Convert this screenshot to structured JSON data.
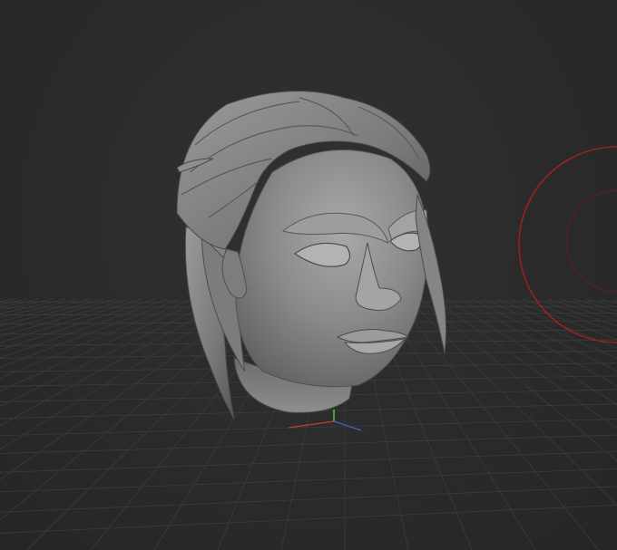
{
  "viewport": {
    "type": "3d-sculpt-viewport",
    "background": "#2b2b2b",
    "grid_color": "#3c3c3c",
    "model": {
      "name": "sculpted-female-head",
      "material_color": "#8a8a8a"
    },
    "gizmo": {
      "x_axis_color": "#c83a3a",
      "y_axis_color": "#5fbf4a",
      "z_axis_color": "#4a5fd0"
    },
    "brush_cursor": {
      "color": "#b01e1e"
    }
  }
}
